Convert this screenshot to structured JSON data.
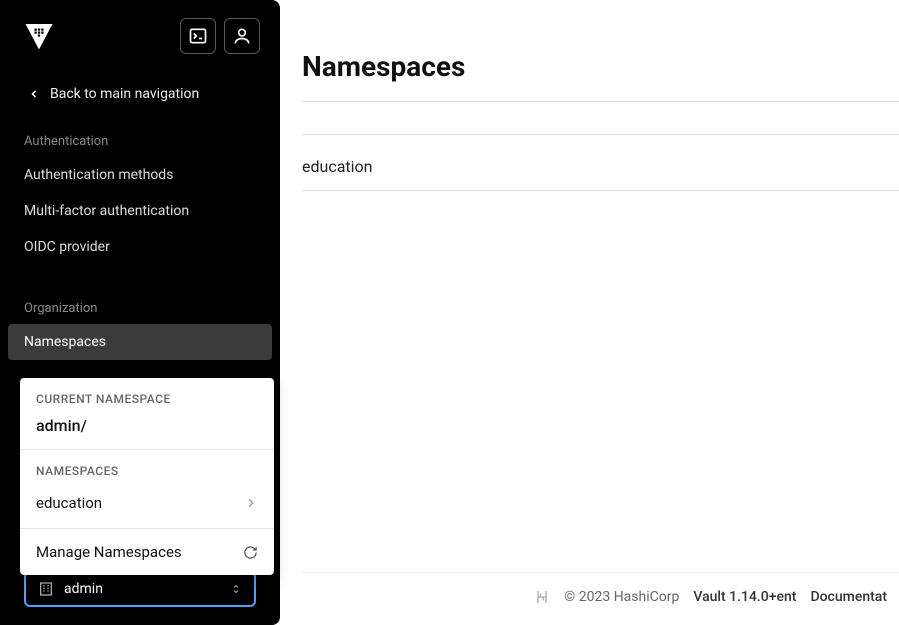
{
  "sidebar": {
    "back_label": "Back to main navigation",
    "sections": [
      {
        "header": "Authentication",
        "items": [
          "Authentication methods",
          "Multi-factor authentication",
          "OIDC provider"
        ]
      },
      {
        "header": "Organization",
        "items": [
          "Namespaces"
        ]
      }
    ]
  },
  "namespace_popup": {
    "current_label": "CURRENT NAMESPACE",
    "current_value": "admin/",
    "list_label": "NAMESPACES",
    "items": [
      "education"
    ],
    "manage_label": "Manage Namespaces"
  },
  "namespace_selector": {
    "value": "admin"
  },
  "main": {
    "title": "Namespaces",
    "rows": [
      "education"
    ]
  },
  "footer": {
    "copyright": "© 2023 HashiCorp",
    "version": "Vault 1.14.0+ent",
    "doc": "Documentat"
  }
}
